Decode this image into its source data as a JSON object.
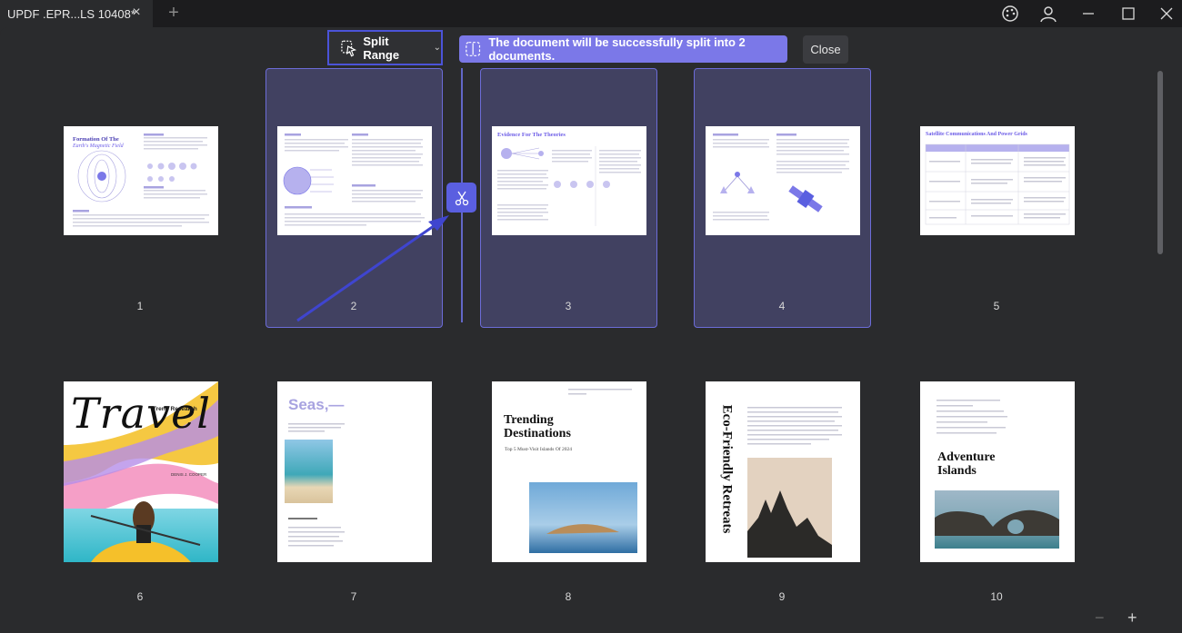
{
  "tab": {
    "title": "UPDF .EPR...LS 10408*",
    "close_icon": "×"
  },
  "toolbar": {
    "split_label": "Split Range"
  },
  "banner": {
    "text": "The document will be successfully split into 2 documents."
  },
  "close_label": "Close",
  "pages": [
    {
      "num": "1",
      "title": "Formation Of The",
      "subtitle": "Earth's Magnetic Field"
    },
    {
      "num": "2"
    },
    {
      "num": "3",
      "title": "Evidence For The Theories"
    },
    {
      "num": "4"
    },
    {
      "num": "5",
      "title": "Satellite Communications And Power Grids"
    },
    {
      "num": "6",
      "title": "Travel",
      "subtitle": "Trend Research",
      "author": "DENIS J. COOPER"
    },
    {
      "num": "7",
      "title": "Seas,—"
    },
    {
      "num": "8",
      "title": "Trending Destinations",
      "subtitle": "Top 5 Must-Visit Islands Of 2024"
    },
    {
      "num": "9",
      "title": "Eco-Friendly Retreats"
    },
    {
      "num": "10",
      "title": "Adventure Islands"
    }
  ],
  "zoom": {
    "minus": "−",
    "plus": "+"
  },
  "colors": {
    "accent": "#5a5fe0",
    "banner": "#7b78e8",
    "selection": "#6c6cd8"
  }
}
